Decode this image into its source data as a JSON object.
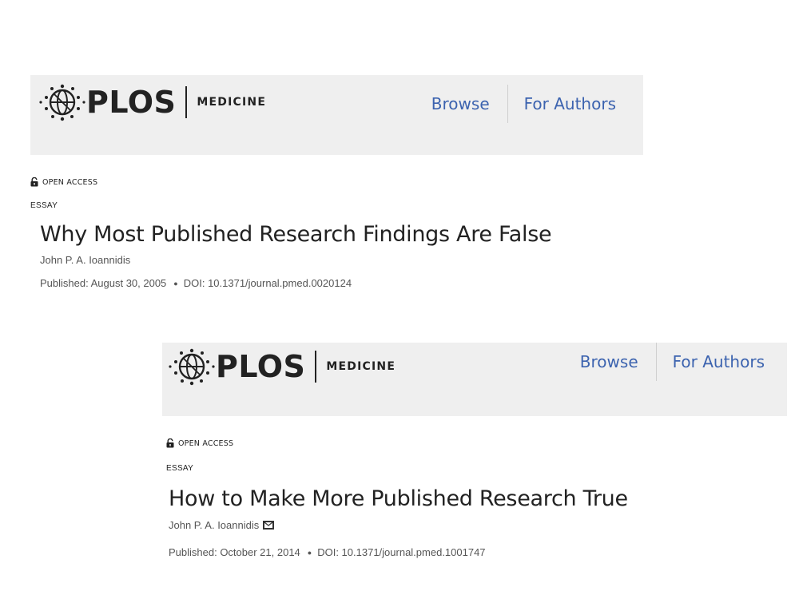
{
  "articles": [
    {
      "brand": {
        "name": "PLOS",
        "journal": "MEDICINE"
      },
      "nav": {
        "browse": "Browse",
        "for_authors": "For Authors"
      },
      "access_label": "OPEN ACCESS",
      "article_type": "ESSAY",
      "title": "Why Most Published Research Findings Are False",
      "author": "John P. A. Ioannidis",
      "published": "Published: August 30, 2005",
      "doi": "DOI: 10.1371/journal.pmed.0020124"
    },
    {
      "brand": {
        "name": "PLOS",
        "journal": "MEDICINE"
      },
      "nav": {
        "browse": "Browse",
        "for_authors": "For Authors"
      },
      "access_label": "OPEN ACCESS",
      "article_type": "ESSAY",
      "title": "How to Make More Published Research True",
      "author": "John P. A. Ioannidis",
      "published": "Published: October 21, 2014",
      "doi": "DOI: 10.1371/journal.pmed.1001747"
    }
  ],
  "icons": {
    "logo": "plos-globe-logo-icon",
    "lock": "open-lock-icon",
    "mail": "envelope-icon"
  },
  "colors": {
    "banner_bg": "#efefef",
    "nav_link": "#3c63af",
    "title": "#222222",
    "meta": "#555555"
  }
}
